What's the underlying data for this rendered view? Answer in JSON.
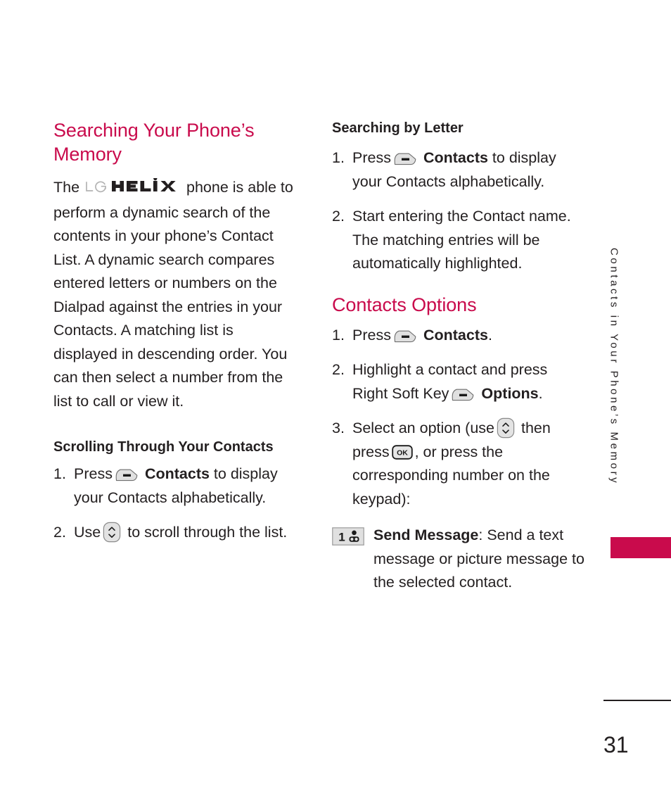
{
  "page": {
    "number": "31",
    "side_tab_label": "Contacts in Your Phone’s Memory",
    "accent_color": "#c90b4c",
    "text_color": "#231f20"
  },
  "left_column": {
    "heading": "Searching Your Phone’s Memory",
    "intro": {
      "before_logo": "The ",
      "logo_lg": "LG",
      "logo_model": "HELiX",
      "after_logo": " phone is able to perform a dynamic search of the contents in your phone’s Contact List. A dynamic search compares entered letters or numbers on the Dialpad against the entries in your Contacts. A matching list is displayed in descending order. You can then select a number from the list to call or view it."
    },
    "subheading": "Scrolling Through Your Contacts",
    "steps": [
      {
        "num": "1.",
        "part1": "Press",
        "icon": "soft-key-icon",
        "bold": "Contacts",
        "part2": "to display your Contacts alphabetically."
      },
      {
        "num": "2.",
        "part1": "Use",
        "icon": "navigation-key-icon",
        "part2": "to scroll through the list."
      }
    ]
  },
  "right_column": {
    "subheading": "Searching by Letter",
    "letter_steps": [
      {
        "num": "1.",
        "part1": "Press",
        "icon": "soft-key-icon",
        "bold": "Contacts",
        "part2": "to display your Contacts alphabetically."
      },
      {
        "num": "2.",
        "text": "Start entering the Contact name. The matching entries will be automatically highlighted."
      }
    ],
    "options_heading": "Contacts Options",
    "options_steps": [
      {
        "num": "1.",
        "part1": "Press",
        "icon": "soft-key-icon",
        "bold": "Contacts",
        "part2": "."
      },
      {
        "num": "2.",
        "part1": "Highlight a contact and press Right Soft Key",
        "icon": "soft-key-icon",
        "bold": "Options",
        "part2": "."
      },
      {
        "num": "3.",
        "part1": "Select an option (use",
        "icon1": "navigation-key-icon",
        "part2": "then press",
        "icon2": "ok-key-icon",
        "part3": ", or press the corresponding number on the keypad):"
      }
    ],
    "option_items": [
      {
        "key_icon": "keypad-one-icon",
        "key_label": "1",
        "title": "Send Message",
        "description": ": Send a text message or picture message to the selected contact."
      }
    ]
  }
}
